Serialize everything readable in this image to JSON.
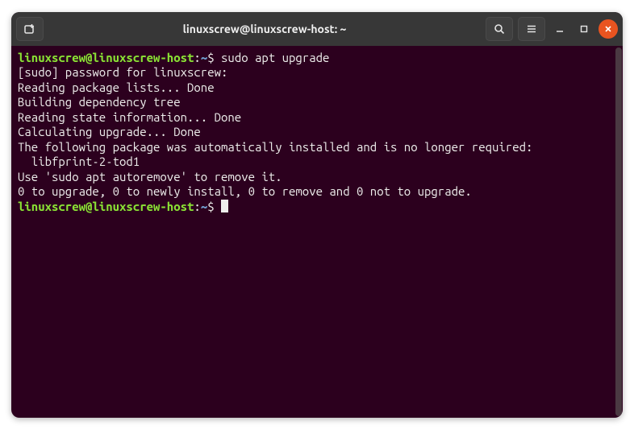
{
  "titlebar": {
    "title": "linuxscrew@linuxscrew-host: ~"
  },
  "terminal": {
    "prompt1_user": "linuxscrew@linuxscrew-host",
    "prompt1_colon": ":",
    "prompt1_path": "~",
    "prompt1_dollar": "$ ",
    "cmd1": "sudo apt upgrade",
    "line2": "[sudo] password for linuxscrew:",
    "line3": "Reading package lists... Done",
    "line4": "Building dependency tree",
    "line5": "Reading state information... Done",
    "line6": "Calculating upgrade... Done",
    "line7": "The following package was automatically installed and is no longer required:",
    "line8": "  libfprint-2-tod1",
    "line9": "Use 'sudo apt autoremove' to remove it.",
    "line10": "0 to upgrade, 0 to newly install, 0 to remove and 0 not to upgrade.",
    "prompt2_user": "linuxscrew@linuxscrew-host",
    "prompt2_colon": ":",
    "prompt2_path": "~",
    "prompt2_dollar": "$ "
  },
  "colors": {
    "terminal_bg": "#2c001e",
    "titlebar_bg": "#373737",
    "text": "#eeeeec",
    "prompt_green": "#8ae234",
    "prompt_blue": "#729fcf",
    "close_orange": "#e95420"
  }
}
